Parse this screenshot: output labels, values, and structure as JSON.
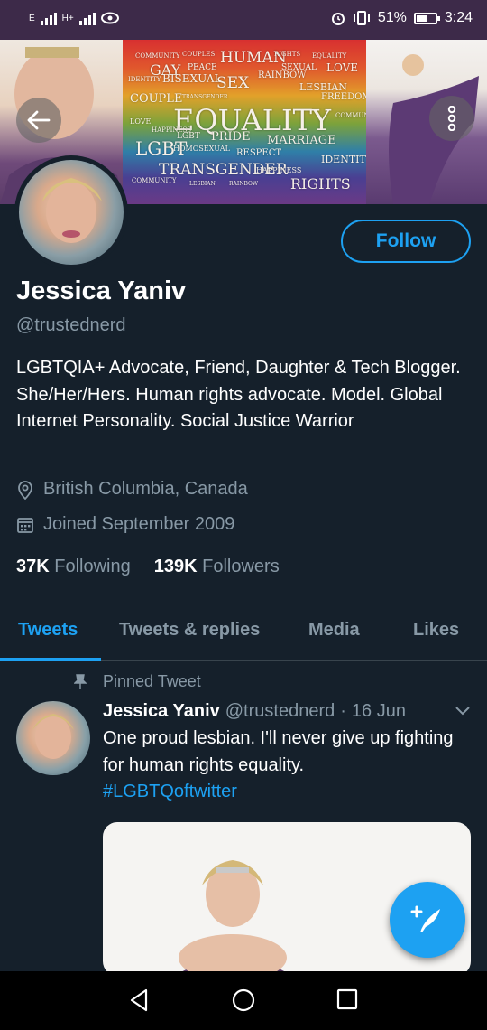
{
  "status_bar": {
    "net1": "E",
    "net2": "H+",
    "battery_pct": "51%",
    "time": "3:24"
  },
  "banner": {
    "words": [
      "COMMUNITY",
      "COUPLES",
      "HUMAN",
      "RIGHTS",
      "EQUALITY",
      "GAY",
      "PEACE",
      "SEXUAL",
      "LOVE",
      "IDENTITY",
      "BISEXUAL",
      "SEX",
      "RAINBOW",
      "LESBIAN",
      "COUPLE",
      "TRANSGENDER",
      "FREEDOM",
      "EQUALITY",
      "LOVE",
      "COMMUNITY",
      "HAPPINESS",
      "PRIDE",
      "MARRIAGE",
      "LGBT",
      "LGBT",
      "HOMOSEXUAL",
      "RESPECT",
      "IDENTITY",
      "TRANSGENDER",
      "HAPPINESS",
      "RIGHTS",
      "COMMUNITY",
      "LESBIAN",
      "RAINBOW"
    ]
  },
  "profile": {
    "follow_label": "Follow",
    "name": "Jessica Yaniv",
    "handle": "@trustednerd",
    "bio": "LGBTQIA+ Advocate, Friend, Daughter & Tech Blogger. She/Her/Hers. Human rights advocate. Model. Global Internet Personality. Social Justice Warrior",
    "location": "British Columbia, Canada",
    "joined": "Joined September 2009",
    "following_count": "37K",
    "following_label": "Following",
    "followers_count": "139K",
    "followers_label": "Followers"
  },
  "tabs": [
    {
      "label": "Tweets",
      "active": true
    },
    {
      "label": "Tweets & replies",
      "active": false
    },
    {
      "label": "Media",
      "active": false
    },
    {
      "label": "Likes",
      "active": false
    }
  ],
  "tweet": {
    "pinned_label": "Pinned Tweet",
    "author_name": "Jessica Yaniv",
    "author_handle": "@trustednerd",
    "separator": "·",
    "date": "16 Jun",
    "text": "One proud lesbian. I'll never give up fighting for human rights equality.",
    "hashtag": "#LGBTQoftwitter"
  },
  "colors": {
    "background": "#15202b",
    "accent": "#1da1f2",
    "secondary_text": "#8899a6",
    "status_bar": "#3d2a49"
  },
  "icons": {
    "back": "arrow-left-icon",
    "more": "more-vertical-icon",
    "location": "location-pin-icon",
    "calendar": "calendar-icon",
    "pin": "pin-icon",
    "chevron": "chevron-down-icon",
    "compose": "compose-tweet-icon",
    "nav_back": "triangle-back-icon",
    "nav_home": "circle-home-icon",
    "nav_recent": "square-recents-icon"
  }
}
